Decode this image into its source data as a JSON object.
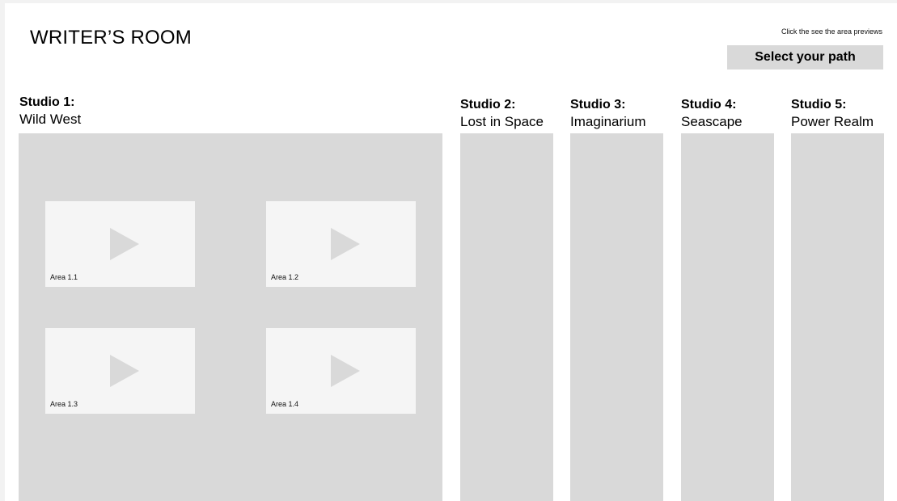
{
  "header": {
    "title": "WRITER’S ROOM",
    "hint": "Click the see the area previews",
    "select_label": "Select your path"
  },
  "studios": [
    {
      "number": "Studio 1:",
      "name": "Wild West",
      "areas": [
        {
          "label": "Area 1.1",
          "icon": "play-icon"
        },
        {
          "label": "Area 1.2",
          "icon": "play-icon"
        },
        {
          "label": "Area 1.3",
          "icon": "play-icon"
        },
        {
          "label": "Area 1.4",
          "icon": "play-icon"
        }
      ]
    },
    {
      "number": "Studio 2:",
      "name": "Lost in Space"
    },
    {
      "number": "Studio 3:",
      "name": "Imaginarium"
    },
    {
      "number": "Studio 4:",
      "name": "Seascape"
    },
    {
      "number": "Studio 5:",
      "name": "Power Realm"
    }
  ],
  "colors": {
    "panel": "#d9d9d9",
    "card": "#f5f5f5",
    "background": "#ffffff"
  }
}
